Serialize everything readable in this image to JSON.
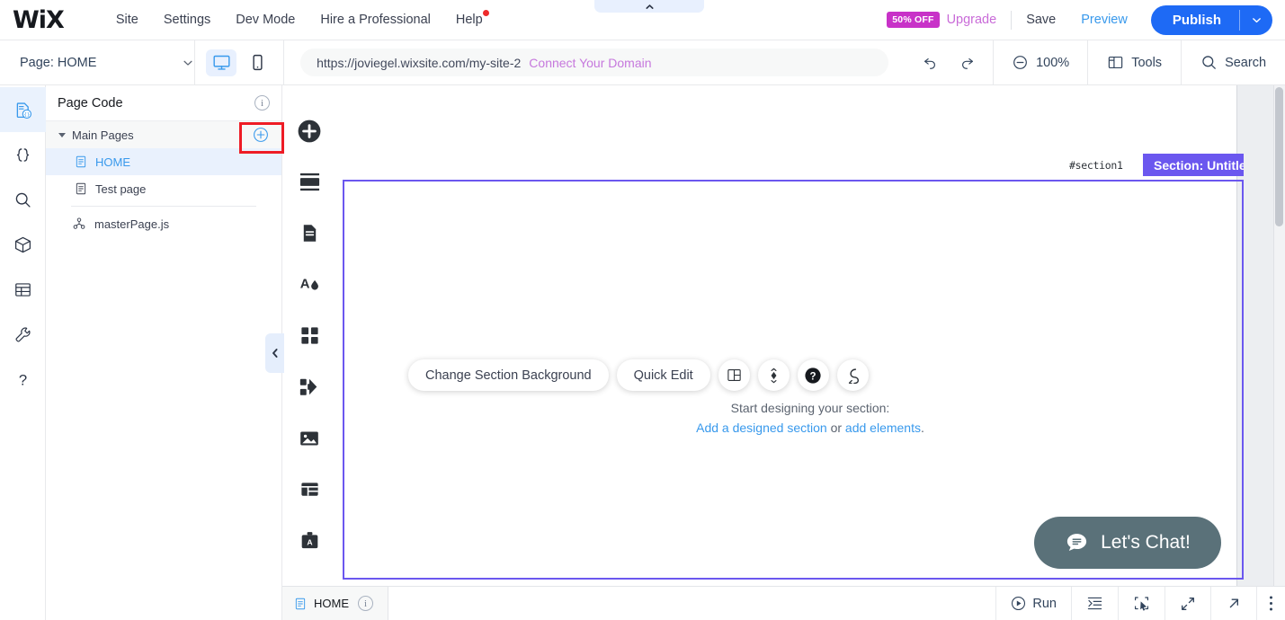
{
  "topbar": {
    "logo": "WiX",
    "nav": [
      {
        "label": "Site"
      },
      {
        "label": "Settings"
      },
      {
        "label": "Dev Mode"
      },
      {
        "label": "Hire a Professional"
      },
      {
        "label": "Help",
        "badge": true
      }
    ],
    "offer_badge": "50% OFF",
    "upgrade": "Upgrade",
    "save": "Save",
    "preview": "Preview",
    "publish": "Publish"
  },
  "secondbar": {
    "page_selector": "Page: HOME",
    "view_desktop_icon": "desktop-icon",
    "view_mobile_icon": "mobile-icon",
    "url": "https://joviegel.wixsite.com/my-site-2",
    "connect_domain": "Connect Your Domain",
    "zoom": "100%",
    "tools": "Tools",
    "search": "Search"
  },
  "rail": [
    {
      "name": "page-code",
      "active": true
    },
    {
      "name": "code-braces",
      "active": false
    },
    {
      "name": "search",
      "active": false
    },
    {
      "name": "package",
      "active": false
    },
    {
      "name": "database",
      "active": false
    },
    {
      "name": "wrench",
      "active": false
    },
    {
      "name": "help-question",
      "active": false
    }
  ],
  "panel": {
    "title": "Page Code",
    "info_icon": "i",
    "group_label": "Main Pages",
    "add_button_icon": "plus-circle-icon",
    "items": [
      {
        "label": "HOME",
        "selected": true,
        "icon": "page-icon"
      },
      {
        "label": "Test page",
        "selected": false,
        "icon": "page-icon"
      },
      {
        "label": "masterPage.js",
        "selected": false,
        "icon": "master-page-icon"
      }
    ]
  },
  "vtoolbar": [
    {
      "name": "add-elements"
    },
    {
      "name": "add-section"
    },
    {
      "name": "pages-menu"
    },
    {
      "name": "theme-design"
    },
    {
      "name": "apps"
    },
    {
      "name": "integrations"
    },
    {
      "name": "media"
    },
    {
      "name": "content-manager"
    },
    {
      "name": "business-tools"
    }
  ],
  "canvas": {
    "section_id": "#section1",
    "section_label": "Section: Untitled",
    "change_background": "Change Section Background",
    "quick_edit": "Quick Edit",
    "tool_icons": [
      "layout-icon",
      "animation-icon",
      "help-icon",
      "behavior-icon"
    ],
    "hint_title": "Start designing your section:",
    "hint_link1": "Add a designed section",
    "hint_or": " or ",
    "hint_link2": "add elements",
    "hint_period": ".",
    "chat_label": "Let's Chat!"
  },
  "bottombar": {
    "tab_label": "HOME",
    "tab_info": "i",
    "run": "Run",
    "buttons": [
      "format-code-icon",
      "select-element-icon",
      "expand-icon",
      "open-external-icon",
      "more-options-icon"
    ]
  },
  "colors": {
    "accent_blue": "#1e6af5",
    "link_blue": "#3899ec",
    "purple": "#6b57ef",
    "magenta": "#c832c8",
    "highlight_red": "#ee1c25",
    "chat_teal": "#5a7179"
  }
}
